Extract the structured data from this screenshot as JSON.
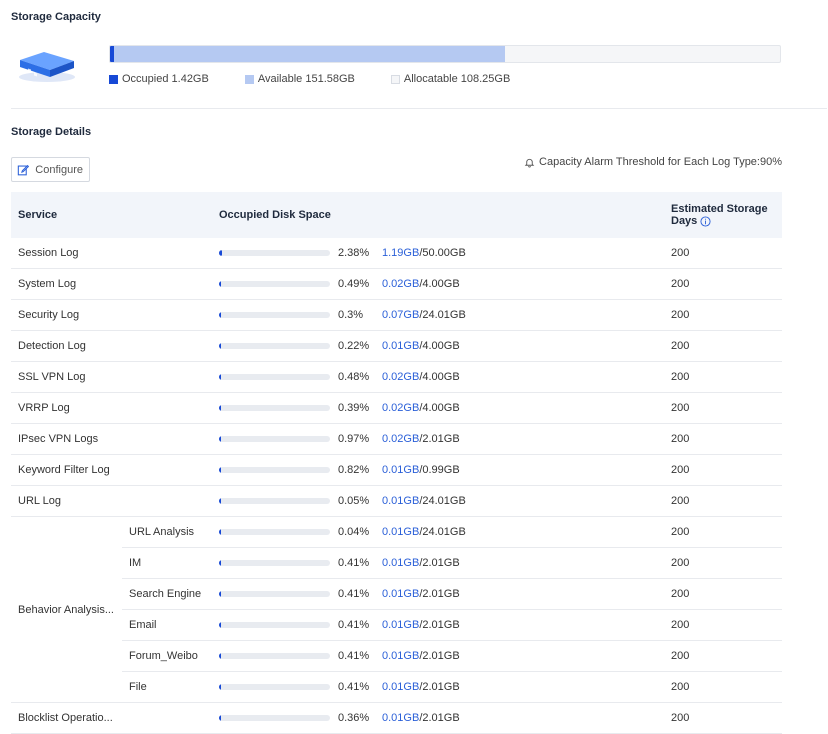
{
  "storage_capacity": {
    "title": "Storage Capacity",
    "occupied_fraction": 0.0024,
    "available_fraction": 0.583,
    "legend": {
      "occupied": "Occupied 1.42GB",
      "available": "Available 151.58GB",
      "allocatable": "Allocatable 108.25GB"
    },
    "colors": {
      "occupied": "#1749d6",
      "available": "#b5c9f2",
      "allocatable": "#f5f6f8"
    }
  },
  "storage_details": {
    "title": "Storage Details",
    "configure_label": "Configure",
    "alarm_text": "Capacity Alarm Threshold for Each Log Type:90%",
    "headers": {
      "service": "Service",
      "disk": "Occupied Disk Space",
      "days": "Estimated Storage Days"
    },
    "rows": [
      {
        "service": "Session Log",
        "pct": "2.38%",
        "used": "1.19GB",
        "total": "/50.00GB",
        "days": "200",
        "fraction": 0.0238
      },
      {
        "service": "System Log",
        "pct": "0.49%",
        "used": "0.02GB",
        "total": "/4.00GB",
        "days": "200",
        "fraction": 0.0049
      },
      {
        "service": "Security Log",
        "pct": "0.3%",
        "used": "0.07GB",
        "total": "/24.01GB",
        "days": "200",
        "fraction": 0.003
      },
      {
        "service": "Detection Log",
        "pct": "0.22%",
        "used": "0.01GB",
        "total": "/4.00GB",
        "days": "200",
        "fraction": 0.0022
      },
      {
        "service": "SSL VPN Log",
        "pct": "0.48%",
        "used": "0.02GB",
        "total": "/4.00GB",
        "days": "200",
        "fraction": 0.0048
      },
      {
        "service": "VRRP Log",
        "pct": "0.39%",
        "used": "0.02GB",
        "total": "/4.00GB",
        "days": "200",
        "fraction": 0.0039
      },
      {
        "service": "IPsec VPN Logs",
        "pct": "0.97%",
        "used": "0.02GB",
        "total": "/2.01GB",
        "days": "200",
        "fraction": 0.0097
      },
      {
        "service": "Keyword Filter Log",
        "pct": "0.82%",
        "used": "0.01GB",
        "total": "/0.99GB",
        "days": "200",
        "fraction": 0.0082
      },
      {
        "service": "URL Log",
        "pct": "0.05%",
        "used": "0.01GB",
        "total": "/24.01GB",
        "days": "200",
        "fraction": 0.0005
      }
    ],
    "behavior_group": {
      "label": "Behavior Analysis...",
      "rows": [
        {
          "service": "URL Analysis",
          "pct": "0.04%",
          "used": "0.01GB",
          "total": "/24.01GB",
          "days": "200",
          "fraction": 0.0004
        },
        {
          "service": "IM",
          "pct": "0.41%",
          "used": "0.01GB",
          "total": "/2.01GB",
          "days": "200",
          "fraction": 0.0041
        },
        {
          "service": "Search Engine",
          "pct": "0.41%",
          "used": "0.01GB",
          "total": "/2.01GB",
          "days": "200",
          "fraction": 0.0041
        },
        {
          "service": "Email",
          "pct": "0.41%",
          "used": "0.01GB",
          "total": "/2.01GB",
          "days": "200",
          "fraction": 0.0041
        },
        {
          "service": "Forum_Weibo",
          "pct": "0.41%",
          "used": "0.01GB",
          "total": "/2.01GB",
          "days": "200",
          "fraction": 0.0041
        },
        {
          "service": "File",
          "pct": "0.41%",
          "used": "0.01GB",
          "total": "/2.01GB",
          "days": "200",
          "fraction": 0.0041
        }
      ]
    },
    "last_row": {
      "service": "Blocklist Operatio...",
      "pct": "0.36%",
      "used": "0.01GB",
      "total": "/2.01GB",
      "days": "200",
      "fraction": 0.0036
    }
  }
}
